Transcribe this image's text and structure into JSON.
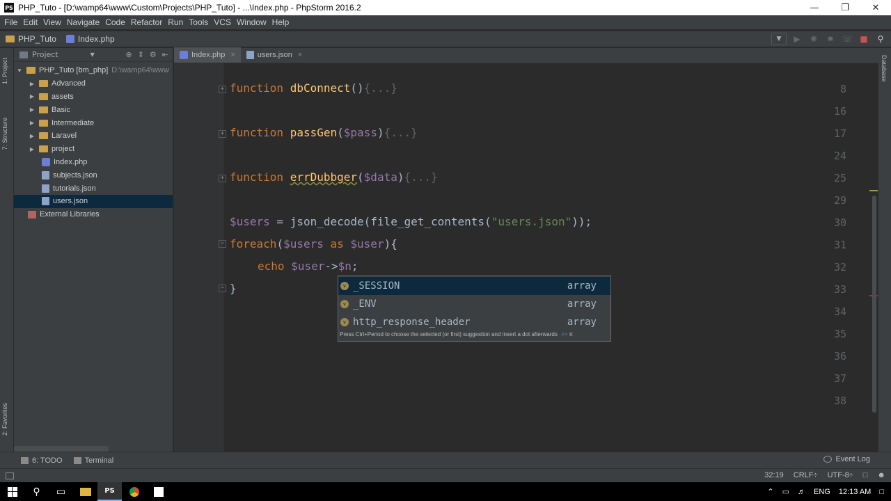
{
  "window": {
    "title": "PHP_Tuto - [D:\\wamp64\\www\\Custom\\Projects\\PHP_Tuto] - ...\\Index.php - PhpStorm 2016.2",
    "icon_label": "PS"
  },
  "menu": [
    "File",
    "Edit",
    "View",
    "Navigate",
    "Code",
    "Refactor",
    "Run",
    "Tools",
    "VCS",
    "Window",
    "Help"
  ],
  "breadcrumb": {
    "project": "PHP_Tuto",
    "file": "Index.php"
  },
  "side_tabs": {
    "project": "1: Project",
    "structure": "7: Structure",
    "favorites": "2: Favorites",
    "database": "Database"
  },
  "project_panel": {
    "header": "Project",
    "root": {
      "name": "PHP_Tuto [bm_php]",
      "path": "D:\\wamp64\\www"
    },
    "folders": [
      "Advanced",
      "assets",
      "Basic",
      "Intermediate",
      "Laravel",
      "project"
    ],
    "files": [
      "Index.php",
      "subjects.json",
      "tutorials.json",
      "users.json"
    ],
    "selected_file": "users.json",
    "libraries": "External Libraries"
  },
  "tabs": [
    {
      "label": "Index.php",
      "active": true
    },
    {
      "label": "users.json",
      "active": false
    }
  ],
  "editor": {
    "line_numbers": [
      "8",
      "16",
      "17",
      "24",
      "25",
      "29",
      "30",
      "31",
      "32",
      "33",
      "34",
      "35",
      "36",
      "37",
      "38"
    ],
    "code": {
      "l8_kw": "function",
      "l8_fn": "dbConnect",
      "l8_rest": "()",
      "l8_fold": "{...}",
      "l17_kw": "function",
      "l17_fn": "passGen",
      "l17_open": "(",
      "l17_var": "$pass",
      "l17_close": ")",
      "l17_fold": "{...}",
      "l25_kw": "function",
      "l25_fn": "errDubbger",
      "l25_open": "(",
      "l25_var": "$data",
      "l25_close": ")",
      "l25_fold": "{...}",
      "l30_var": "$users",
      "l30_mid": " = json_decode(file_get_contents(",
      "l30_str": "\"users.json\"",
      "l30_end": "));",
      "l31_kw": "foreach",
      "l31_open": "(",
      "l31_var1": "$users",
      "l31_as": " as ",
      "l31_var2": "$user",
      "l31_end": "){",
      "l32_kw": "echo",
      "l32_var1": "$user",
      "l32_arrow": "->",
      "l32_var2": "$n",
      "l32_end": ";",
      "l33": "}"
    }
  },
  "completion": {
    "items": [
      {
        "name": "_SESSION",
        "type": "array",
        "selected": true
      },
      {
        "name": "_ENV",
        "type": "array",
        "selected": false
      },
      {
        "name": "http_response_header",
        "type": "array",
        "selected": false
      }
    ],
    "hint": "Press Ctrl+Period to choose the selected (or first) suggestion and insert a dot afterwards",
    "hint_link": ">>",
    "pi": "π"
  },
  "bottom_tools": {
    "todo": "6: TODO",
    "terminal": "Terminal",
    "event_log": "Event Log"
  },
  "status": {
    "position": "32:19",
    "line_sep": "CRLF÷",
    "encoding": "UTF-8÷"
  },
  "taskbar": {
    "lang": "ENG",
    "time": "12:13 AM"
  }
}
